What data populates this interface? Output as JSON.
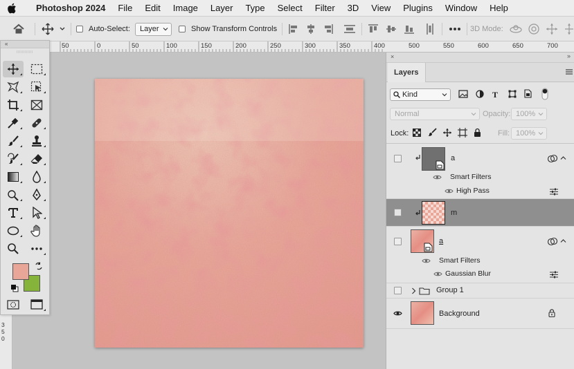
{
  "menubar": {
    "app_name": "Photoshop 2024",
    "items": [
      "File",
      "Edit",
      "Image",
      "Layer",
      "Type",
      "Select",
      "Filter",
      "3D",
      "View",
      "Plugins",
      "Window",
      "Help"
    ]
  },
  "options_bar": {
    "auto_select_label": "Auto-Select:",
    "auto_select_value": "Layer",
    "show_transform_label": "Show Transform Controls",
    "mode_3d_label": "3D Mode:"
  },
  "ruler": {
    "top_labels": [
      "50",
      "0",
      "50",
      "100",
      "150",
      "200",
      "250",
      "300",
      "350",
      "400",
      "450",
      "500",
      "550",
      "600",
      "650",
      "700"
    ],
    "left_labels": [
      "3",
      "5",
      "0"
    ]
  },
  "layers_panel": {
    "tab_label": "Layers",
    "filter_kind": "Kind",
    "blend_mode": "Normal",
    "opacity_label": "Opacity:",
    "opacity_value": "100%",
    "lock_label": "Lock:",
    "fill_label": "Fill:",
    "fill_value": "100%",
    "layers": [
      {
        "name": "a",
        "smart_filters_label": "Smart Filters",
        "filter": "High Pass"
      },
      {
        "name": "m"
      },
      {
        "name": "a",
        "smart_filters_label": "Smart Filters",
        "filter": "Gaussian Blur"
      },
      {
        "name": "Group 1"
      },
      {
        "name": "Background"
      }
    ]
  },
  "colors": {
    "foreground": "#e8a698",
    "background": "#86b33a",
    "selected_layer": "#8f8f8f"
  }
}
